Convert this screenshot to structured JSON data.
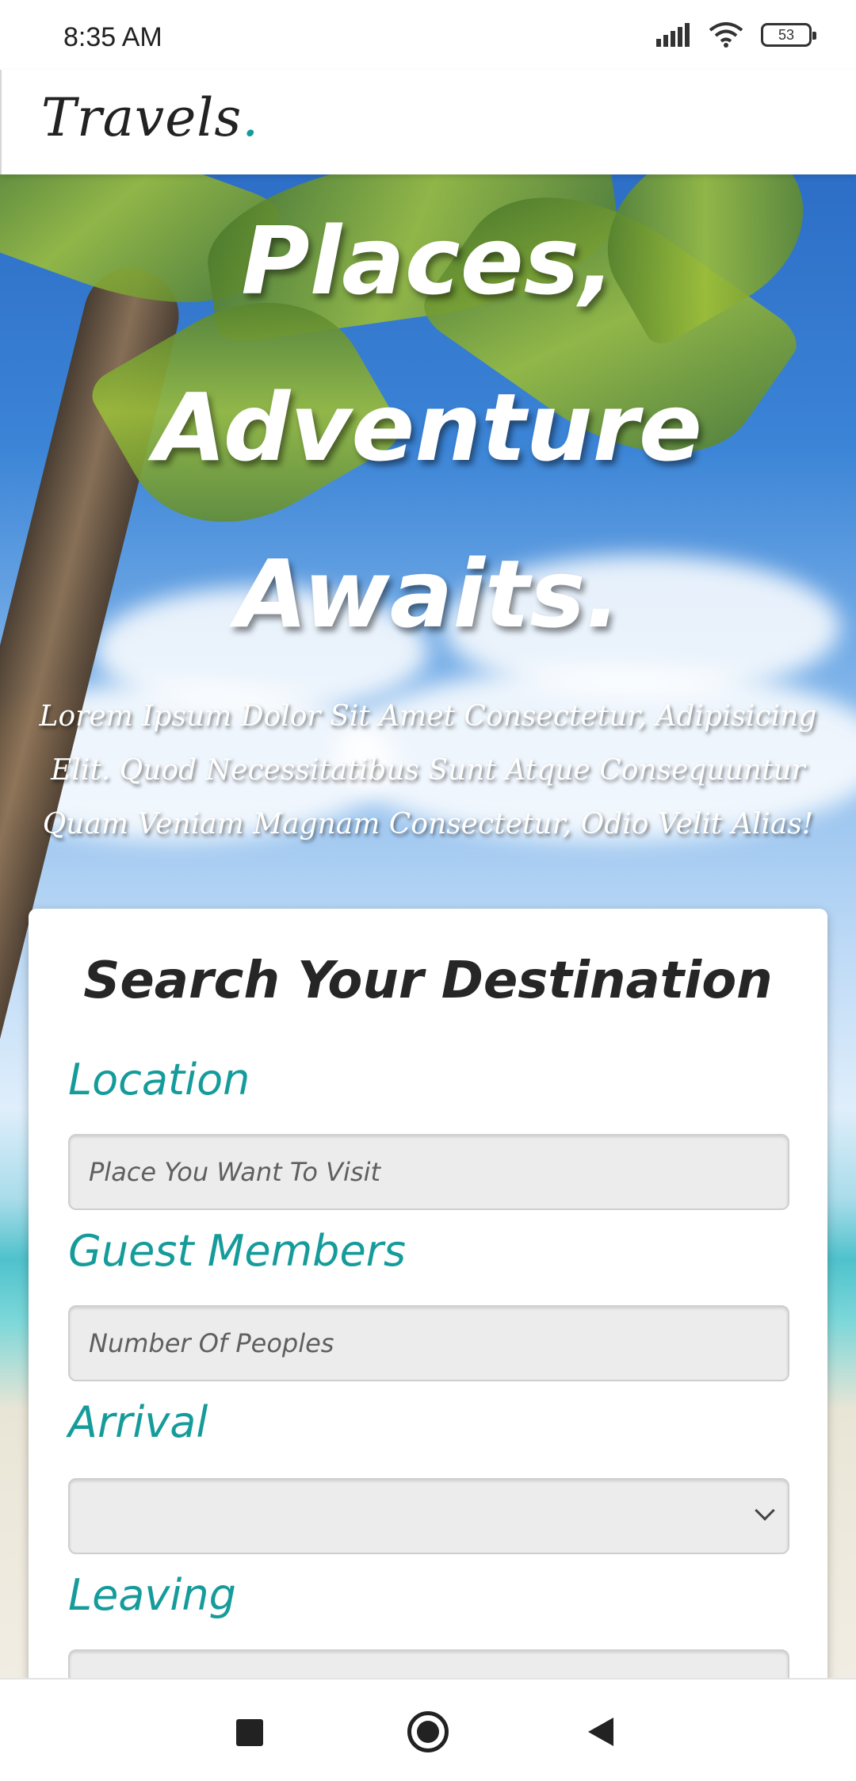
{
  "status_bar": {
    "time": "8:35 AM",
    "battery": "53",
    "icons": [
      "signal-icon",
      "wifi-icon",
      "battery-icon"
    ]
  },
  "header": {
    "logo_text": "Travels",
    "logo_dot": ".",
    "accent_color": "#169b9b"
  },
  "hero": {
    "title_lines": [
      "Places,",
      "Adventure",
      "Awaits."
    ],
    "text": "Lorem Ipsum Dolor Sit Amet Consectetur, Adipisicing Elit. Quod Necessitatibus Sunt Atque Consequuntur Quam Veniam Magnam Consectetur, Odio Velit Alias!"
  },
  "search": {
    "title": "Search Your Destination",
    "location_label": "Location",
    "location_placeholder": "Place You Want To Visit",
    "guests_label": "Guest Members",
    "guests_placeholder": "Number Of Peoples",
    "arrival_label": "Arrival",
    "arrival_value": "",
    "leaving_label": "Leaving",
    "leaving_value": ""
  },
  "nav_bar": {
    "buttons": [
      "recent-apps",
      "home",
      "back"
    ]
  }
}
